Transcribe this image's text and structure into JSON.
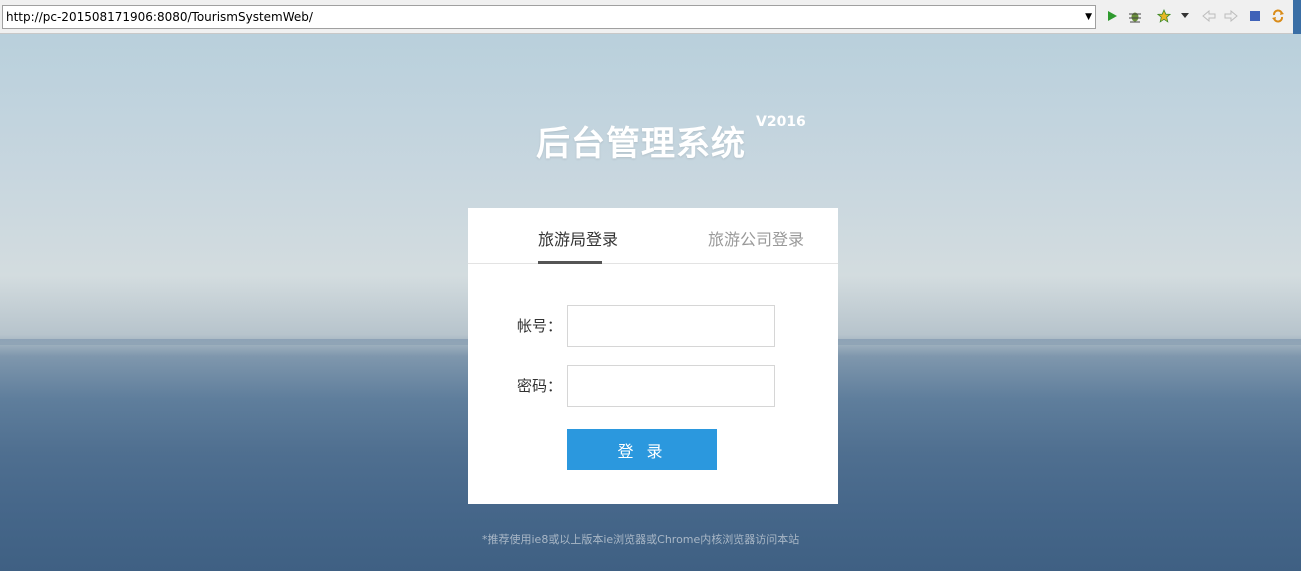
{
  "browser": {
    "url": "http://pc-201508171906:8080/TourismSystemWeb/",
    "dropdown_glyph": "▼",
    "toolbar_icons": [
      "run-icon",
      "debug-icon",
      "favorite-star-icon",
      "back-icon",
      "forward-icon",
      "stop-icon",
      "refresh-icon"
    ]
  },
  "page": {
    "title": "后台管理系统",
    "version": "V2016"
  },
  "login": {
    "tabs": [
      {
        "label": "旅游局登录",
        "active": true
      },
      {
        "label": "旅游公司登录",
        "active": false
      }
    ],
    "account_label": "帐号：",
    "account_value": "",
    "password_label": "密码：",
    "password_value": "",
    "submit_label": "登 录"
  },
  "footer": {
    "note": "*推荐使用ie8或以上版本ie浏览器或Chrome内核浏览器访问本站"
  },
  "colors": {
    "accent": "#2b98de",
    "active_tab_text": "#333333",
    "inactive_tab_text": "#999999"
  }
}
